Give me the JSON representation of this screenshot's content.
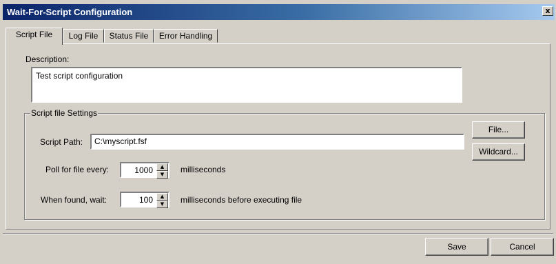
{
  "window": {
    "title": "Wait-For-Script Configuration",
    "close_glyph": "x"
  },
  "tabs": [
    {
      "label": "Script File",
      "active": true
    },
    {
      "label": "Log File",
      "active": false
    },
    {
      "label": "Status File",
      "active": false
    },
    {
      "label": "Error Handling",
      "active": false
    }
  ],
  "description": {
    "label": "Description:",
    "value": "Test script configuration"
  },
  "script_settings": {
    "group_title": "Script file Settings",
    "path_label": "Script Path:",
    "path_value": "C:\\myscript.fsf",
    "file_button": "File...",
    "wildcard_button": "Wildcard...",
    "poll_label": "Poll for file every:",
    "poll_value": "1000",
    "poll_units": "milliseconds",
    "wait_label": "When found, wait:",
    "wait_value": "100",
    "wait_units": "milliseconds before executing file"
  },
  "footer": {
    "save_label": "Save",
    "cancel_label": "Cancel"
  },
  "icons": {
    "spin_up": "up-arrow-icon",
    "spin_down": "down-arrow-icon"
  },
  "colors": {
    "title_bar_start": "#0a246a",
    "title_bar_end": "#a6caf0",
    "face": "#d4d0c8"
  }
}
